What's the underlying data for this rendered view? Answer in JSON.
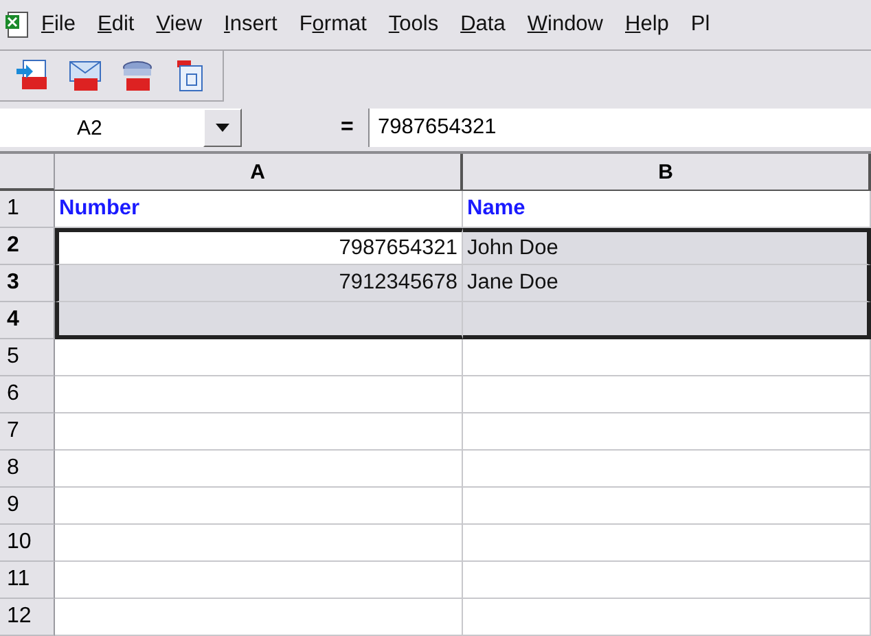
{
  "menu": [
    {
      "access_key": "F",
      "rest": "ile"
    },
    {
      "access_key": "E",
      "rest": "dit"
    },
    {
      "access_key": "V",
      "rest": "iew"
    },
    {
      "access_key": "I",
      "rest": "nsert"
    },
    {
      "lead": "F",
      "access_key": "o",
      "rest": "rmat"
    },
    {
      "access_key": "T",
      "rest": "ools"
    },
    {
      "access_key": "D",
      "rest": "ata"
    },
    {
      "access_key": "W",
      "rest": "indow"
    },
    {
      "access_key": "H",
      "rest": "elp"
    },
    {
      "lead": "Pl"
    }
  ],
  "toolbar": [
    {
      "kind": "export"
    },
    {
      "kind": "mail"
    },
    {
      "kind": "convert"
    },
    {
      "kind": "document"
    }
  ],
  "formula_bar": {
    "name_box": "A2",
    "equals": "=",
    "value": "7987654321"
  },
  "columns": [
    {
      "label": "A",
      "selected": true
    },
    {
      "label": "B",
      "selected": true
    }
  ],
  "rows": [
    {
      "label": "1",
      "selected": false,
      "cells": [
        {
          "text": "Number",
          "kind": "heading",
          "active": false
        },
        {
          "text": "Name",
          "kind": "heading",
          "active": false
        }
      ]
    },
    {
      "label": "2",
      "selected": true,
      "cells": [
        {
          "text": "7987654321",
          "kind": "number",
          "active": true
        },
        {
          "text": "John Doe",
          "kind": "text",
          "active": false
        }
      ]
    },
    {
      "label": "3",
      "selected": true,
      "cells": [
        {
          "text": "7912345678",
          "kind": "number",
          "active": false
        },
        {
          "text": "Jane Doe",
          "kind": "text",
          "active": false
        }
      ]
    },
    {
      "label": "4",
      "selected": true
    },
    {
      "label": "5",
      "selected": false
    },
    {
      "label": "6",
      "selected": false
    },
    {
      "label": "7",
      "selected": false
    },
    {
      "label": "8",
      "selected": false
    },
    {
      "label": "9",
      "selected": false
    },
    {
      "label": "10",
      "selected": false
    },
    {
      "label": "11",
      "selected": false
    },
    {
      "label": "12",
      "selected": false
    }
  ]
}
